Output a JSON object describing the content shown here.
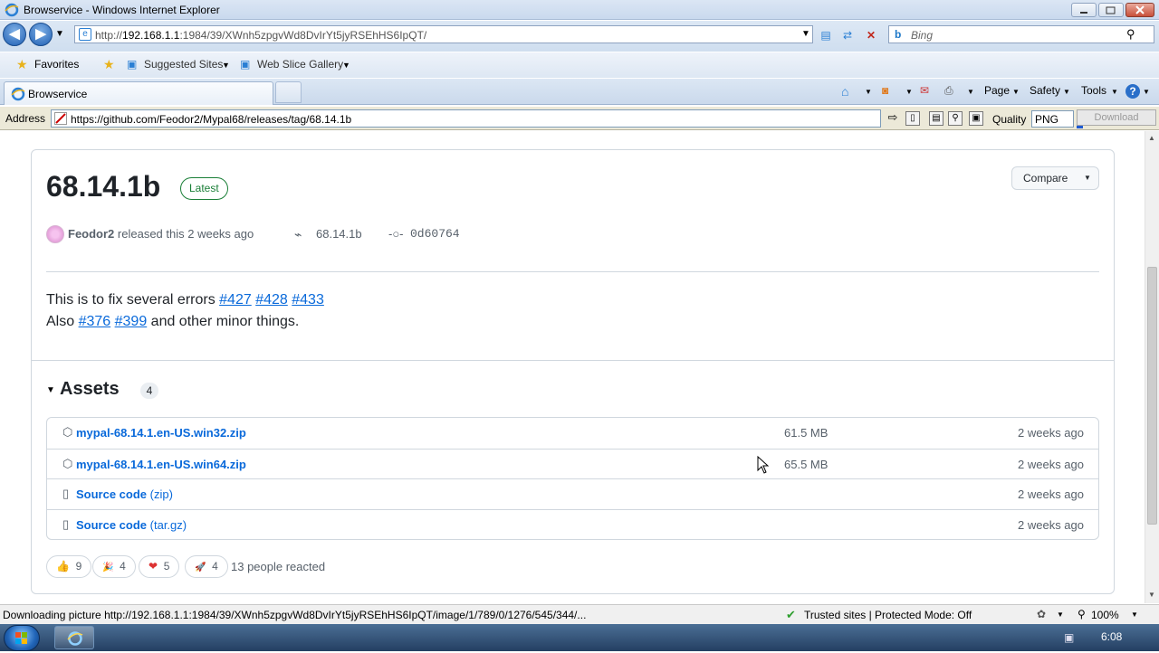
{
  "window": {
    "title": "Browservice - Windows Internet Explorer"
  },
  "nav": {
    "url_prefix": "http://",
    "url_host": "192.168.1.1",
    "url_rest": ":1984/39/XWnh5zpgvWd8DvIrYt5jyRSEhHS6IpQT/",
    "search_placeholder": "Bing"
  },
  "favorites_bar": {
    "favorites_label": "Favorites",
    "suggested_sites": "Suggested Sites",
    "web_slice_gallery": "Web Slice Gallery"
  },
  "tabs": [
    {
      "label": "Browservice"
    }
  ],
  "command_bar": {
    "page": "Page",
    "safety": "Safety",
    "tools": "Tools"
  },
  "address_bar": {
    "label": "Address",
    "url": "https://github.com/Feodor2/Mypal68/releases/tag/68.14.1b",
    "quality_label": "Quality",
    "quality_value": "PNG",
    "download_label": "Download"
  },
  "release": {
    "version": "68.14.1b",
    "badge": "Latest",
    "compare_label": "Compare",
    "author": "Feodor2",
    "released_text": "released this 2 weeks ago",
    "tag": "68.14.1b",
    "commit": "0d60764",
    "body_line1_text": "This is to fix several errors ",
    "body_line1_links": [
      "#427",
      "#428",
      "#433"
    ],
    "body_line2_prefix": "Also ",
    "body_line2_links": [
      "#376",
      "#399"
    ],
    "body_line2_suffix": " and other minor things."
  },
  "assets": {
    "heading": "Assets",
    "count": "4",
    "items": [
      {
        "name": "mypal-68.14.1.en-US.win32.zip",
        "suffix": "",
        "size": "61.5 MB",
        "date": "2 weeks ago"
      },
      {
        "name": "mypal-68.14.1.en-US.win64.zip",
        "suffix": "",
        "size": "65.5 MB",
        "date": "2 weeks ago"
      },
      {
        "name": "Source code",
        "suffix": " (zip)",
        "size": "",
        "date": "2 weeks ago"
      },
      {
        "name": "Source code",
        "suffix": " (tar.gz)",
        "size": "",
        "date": "2 weeks ago"
      }
    ]
  },
  "reactions": {
    "items": [
      {
        "emoji": "👍",
        "count": "9"
      },
      {
        "emoji": "🎉",
        "count": "4"
      },
      {
        "emoji": "❤",
        "count": "5"
      },
      {
        "emoji": "🚀",
        "count": "4"
      }
    ],
    "summary": "13 people reacted"
  },
  "status_bar": {
    "message": "Downloading picture http://192.168.1.1:1984/39/XWnh5zpgvWd8DvIrYt5jyRSEhHS6IpQT/image/1/789/0/1276/545/344/...",
    "zone": "Trusted sites | Protected Mode: Off",
    "zoom": "100%"
  },
  "taskbar": {
    "clock": "6:08"
  },
  "colors": {
    "link": "#0969da",
    "latest_green": "#1a7f37",
    "text": "#1f2328",
    "muted": "#57606a"
  }
}
